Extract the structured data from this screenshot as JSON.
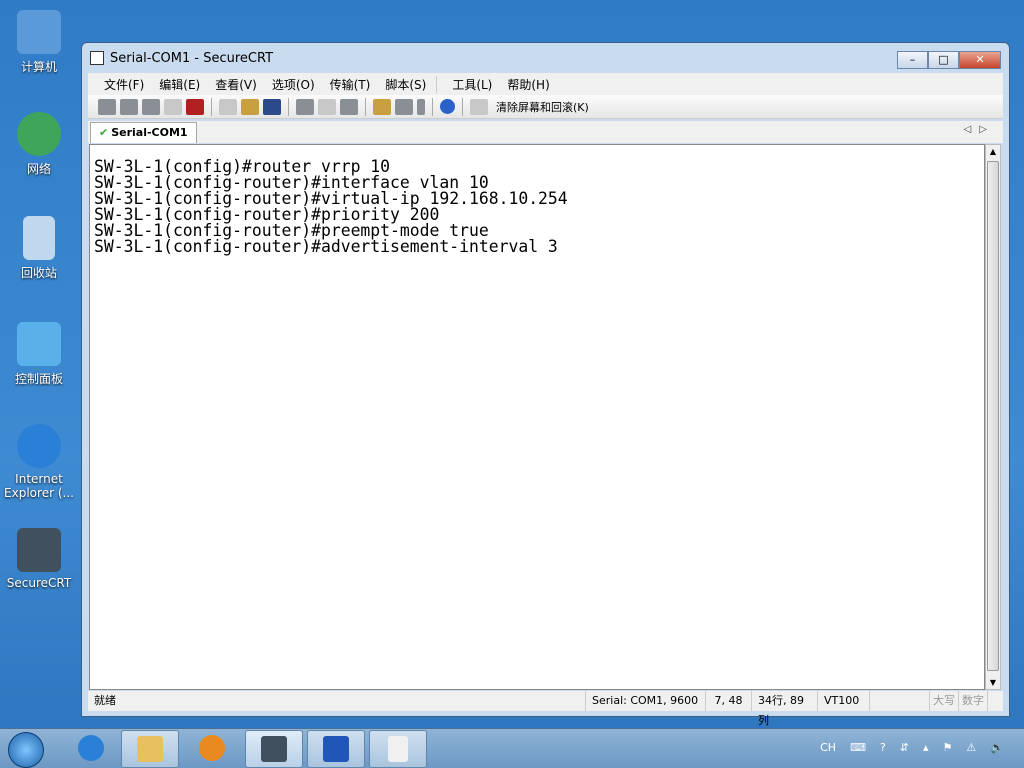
{
  "desktop": {
    "icons": [
      {
        "label": "计算机",
        "color": "#5a9ad8"
      },
      {
        "label": "网络",
        "color": "#3fa55a"
      },
      {
        "label": "回收站",
        "color": "#c0d8ee"
      },
      {
        "label": "控制面板",
        "color": "#5ab0e8"
      },
      {
        "label": "Internet Explorer (...",
        "color": "#2a7fd6"
      },
      {
        "label": "SecureCRT",
        "color": "#40505e"
      }
    ]
  },
  "window": {
    "title": "Serial-COM1 - SecureCRT",
    "controls": {
      "minimize": "–",
      "maximize": "□",
      "close": "✕"
    }
  },
  "menu": [
    "文件(F)",
    "编辑(E)",
    "查看(V)",
    "选项(O)",
    "传输(T)",
    "脚本(S)",
    "工具(L)",
    "帮助(H)"
  ],
  "toolbar": {
    "clear_label": "清除屏幕和回滚(K)"
  },
  "tab": {
    "label": "Serial-COM1",
    "check": "✔",
    "arrows": "◁▷"
  },
  "terminal": {
    "lines": [
      "SW-3L-1(config)#router vrrp 10",
      "SW-3L-1(config-router)#interface vlan 10",
      "SW-3L-1(config-router)#virtual-ip 192.168.10.254",
      "SW-3L-1(config-router)#priority 200",
      "SW-3L-1(config-router)#preempt-mode true",
      "SW-3L-1(config-router)#advertisement-interval 3"
    ]
  },
  "status": {
    "ready": "就绪",
    "connection": "Serial: COM1, 9600",
    "cursor": "7,  48",
    "size": "34行, 89列",
    "emulation": "VT100",
    "caps": "大写",
    "num": "数字"
  },
  "taskbar": {
    "tray": {
      "lang": "CH"
    }
  }
}
